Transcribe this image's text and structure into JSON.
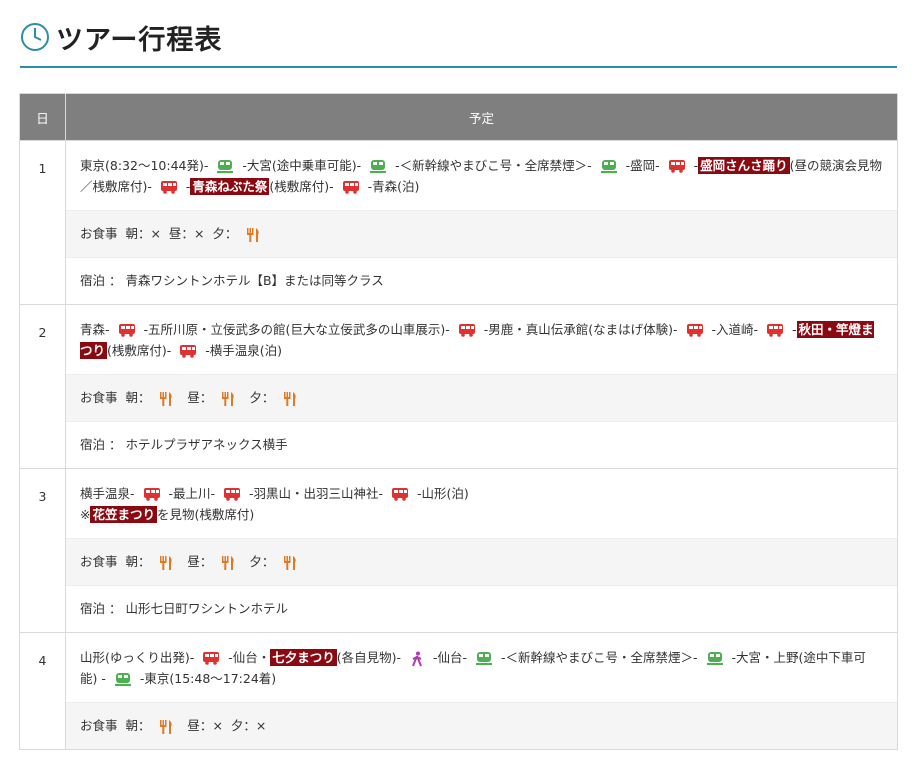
{
  "page": {
    "title": "ツアー行程表"
  },
  "table": {
    "col_day": "日",
    "col_plan": "予定"
  },
  "meal_labels": {
    "prefix": "お食事",
    "morning": "朝：",
    "noon": "昼：",
    "evening": "夕：",
    "none": "×"
  },
  "hotel_prefix": "宿泊 ：",
  "days": [
    {
      "num": "1",
      "r1": "東京(8:32～10:44発)-",
      "r2": "-大宮(途中乗車可能)-",
      "r3": "-＜新幹線やまびこ号・全席禁煙＞-",
      "r4": "-盛岡-",
      "r5": "-",
      "h1": "盛岡さんさ踊り",
      "r6": "(昼の競演会見物／桟敷席付)-",
      "r7": "-",
      "h2": "青森ねぶた祭",
      "r8": "(桟敷席付)-",
      "r9": "-青森(泊)",
      "hotel": "青森ワシントンホテル【B】または同等クラス"
    },
    {
      "num": "2",
      "r1": "青森-",
      "r2": "-五所川原・立佞武多の館(巨大な立佞武多の山車展示)-",
      "r3": "-男鹿・真山伝承館(なまはげ体験)-",
      "r4": "-入道崎-",
      "r5": "-",
      "h1": "秋田・竿燈まつり",
      "r6": "(桟敷席付)-",
      "r7": "-横手温泉(泊)",
      "hotel": "ホテルプラザアネックス横手"
    },
    {
      "num": "3",
      "r1": "横手温泉-",
      "r2": "-最上川-",
      "r3": "-羽黒山・出羽三山神社-",
      "r4": "-山形(泊)",
      "r5": "※",
      "h1": "花笠まつり",
      "r6": "を見物(桟敷席付)",
      "hotel": "山形七日町ワシントンホテル"
    },
    {
      "num": "4",
      "r1": "山形(ゆっくり出発)-",
      "r2": "-仙台・",
      "h1": "七夕まつり",
      "r3": "(各自見物)-",
      "r4": "-仙台-",
      "r5": "-＜新幹線やまびこ号・全席禁煙＞-",
      "r6": "-大宮・上野(途中下車可能)",
      "r7": "-",
      "r8": "-東京(15:48～17:24着)"
    }
  ],
  "icons": {
    "train": "train-icon",
    "bus": "bus-icon",
    "walk": "walking-icon",
    "meal": "fork-knife-icon",
    "clock": "clock-icon"
  },
  "colors": {
    "accent": "#2c8fa8",
    "highlight": "#8b0a12",
    "train": "#4caf50",
    "bus": "#e03030",
    "meal": "#e07a20",
    "walk": "#b03ab0",
    "header": "#7f7f7f"
  }
}
